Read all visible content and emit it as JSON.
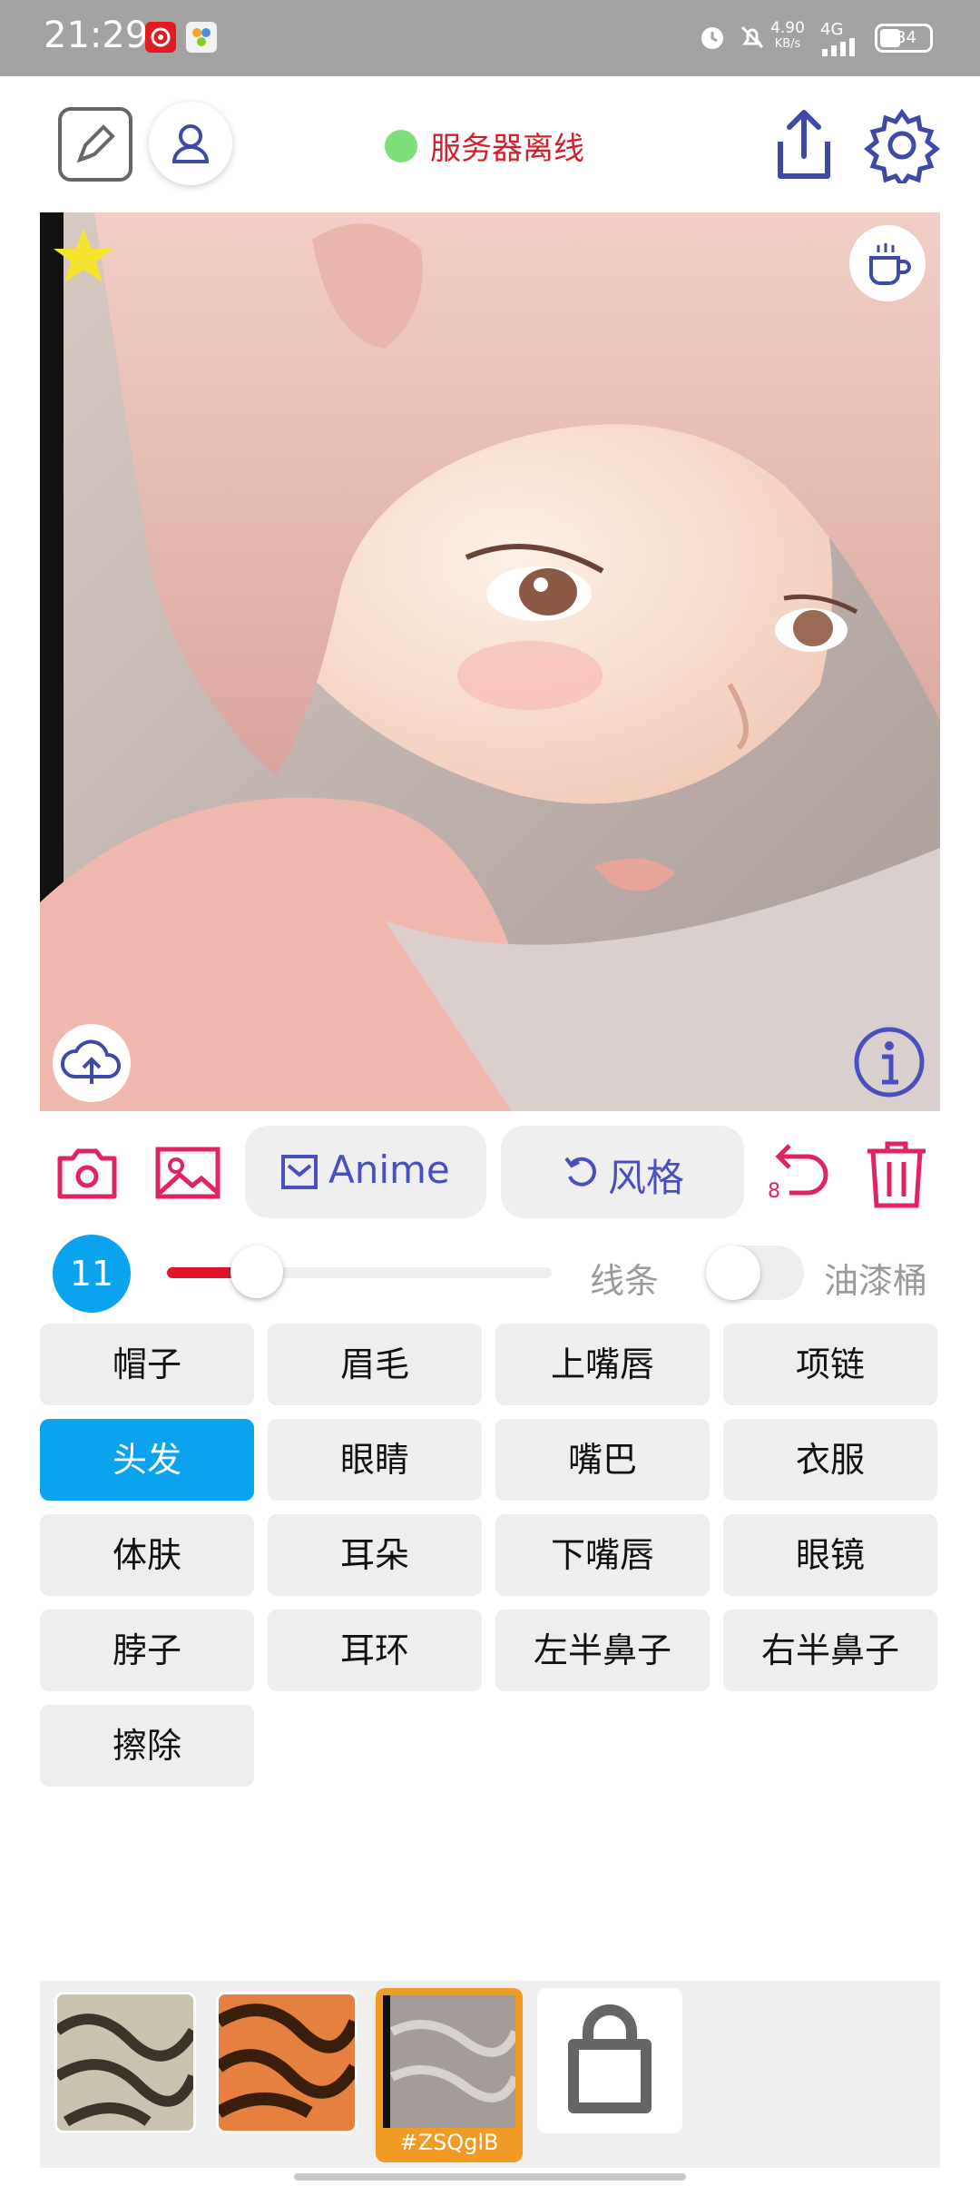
{
  "status_bar": {
    "time": "21:29",
    "net_speed_value": "4.90",
    "net_speed_unit": "KB/s",
    "network": "4G",
    "battery": "34"
  },
  "header": {
    "server_status": "服务器离线",
    "colors": {
      "status_dot": "#7ee07a",
      "status_text": "#d21f2a",
      "accent": "#4a4fc0"
    }
  },
  "toolbar": {
    "anime_label": "Anime",
    "style_label": "风格",
    "undo_count": "8"
  },
  "brush": {
    "size": "11",
    "slider_fraction": 0.18,
    "line_label": "线条",
    "bucket_label": "油漆桶",
    "bucket_enabled": false
  },
  "parts": [
    {
      "label": "帽子"
    },
    {
      "label": "眉毛"
    },
    {
      "label": "上嘴唇"
    },
    {
      "label": "项链"
    },
    {
      "label": "头发",
      "active": true
    },
    {
      "label": "眼睛"
    },
    {
      "label": "嘴巴"
    },
    {
      "label": "衣服"
    },
    {
      "label": "体肤"
    },
    {
      "label": "耳朵"
    },
    {
      "label": "下嘴唇"
    },
    {
      "label": "眼镜"
    },
    {
      "label": "脖子"
    },
    {
      "label": "耳环"
    },
    {
      "label": "左半鼻子"
    },
    {
      "label": "右半鼻子"
    },
    {
      "label": "擦除"
    }
  ],
  "textures": {
    "selected_code": "#ZSQglB",
    "items": [
      "texture-silver",
      "texture-orange",
      "texture-gray"
    ]
  }
}
